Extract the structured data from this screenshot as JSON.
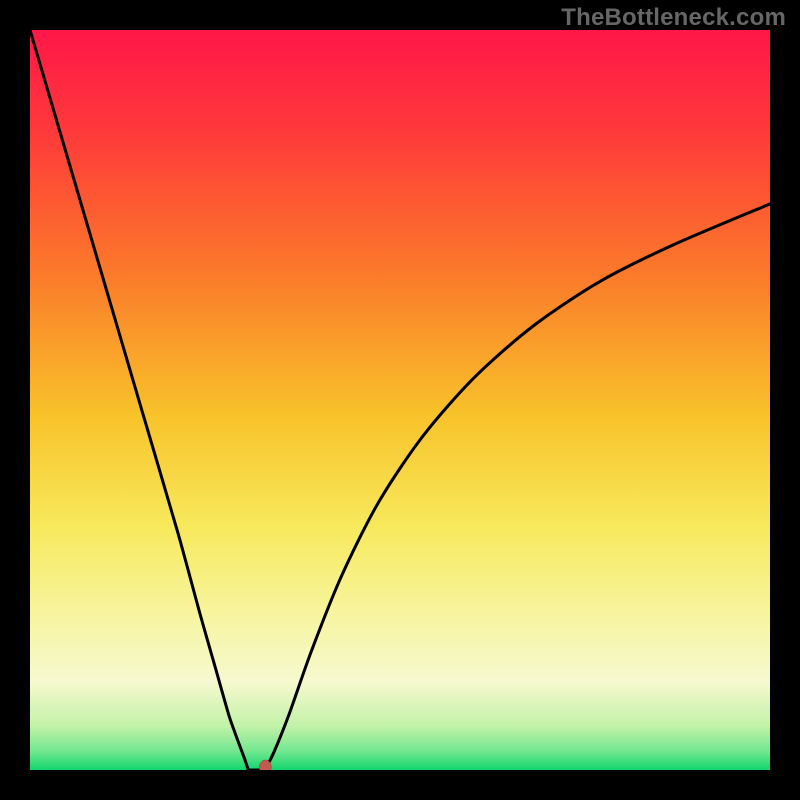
{
  "watermark": "TheBottleneck.com",
  "colors": {
    "page_bg": "#000000",
    "watermark": "#666666",
    "curve": "#000000",
    "marker_fill": "#c45a4f",
    "gradient_stops": [
      {
        "offset": 0.0,
        "color": "#ff1748"
      },
      {
        "offset": 0.14,
        "color": "#ff3a3a"
      },
      {
        "offset": 0.33,
        "color": "#fb7a2a"
      },
      {
        "offset": 0.52,
        "color": "#f8c22a"
      },
      {
        "offset": 0.67,
        "color": "#f7e95b"
      },
      {
        "offset": 0.78,
        "color": "#f7f49a"
      },
      {
        "offset": 0.88,
        "color": "#f6f9cf"
      },
      {
        "offset": 0.94,
        "color": "#c3f2a8"
      },
      {
        "offset": 0.975,
        "color": "#71e78f"
      },
      {
        "offset": 1.0,
        "color": "#12d66c"
      }
    ]
  },
  "chart_data": {
    "type": "line",
    "title": "",
    "xlabel": "",
    "ylabel": "",
    "xlim": [
      0,
      100
    ],
    "ylim": [
      0,
      100
    ],
    "series": [
      {
        "name": "bottleneck-curve",
        "x": [
          0,
          5,
          10,
          15,
          20,
          23,
          25,
          27,
          29,
          30.5,
          31.2,
          32,
          33,
          35,
          38,
          42,
          47,
          53,
          60,
          68,
          77,
          87,
          100
        ],
        "y": [
          100,
          83,
          66,
          49,
          32,
          21,
          14,
          7,
          1.5,
          0.2,
          0,
          0.6,
          2.5,
          7.5,
          16,
          26,
          36,
          45,
          53,
          60,
          66,
          71,
          76.5
        ]
      }
    ],
    "marker": {
      "x": 31.8,
      "y": 0
    },
    "flat_segment": {
      "x_start": 29.5,
      "x_end": 31.2,
      "y": 0
    }
  }
}
